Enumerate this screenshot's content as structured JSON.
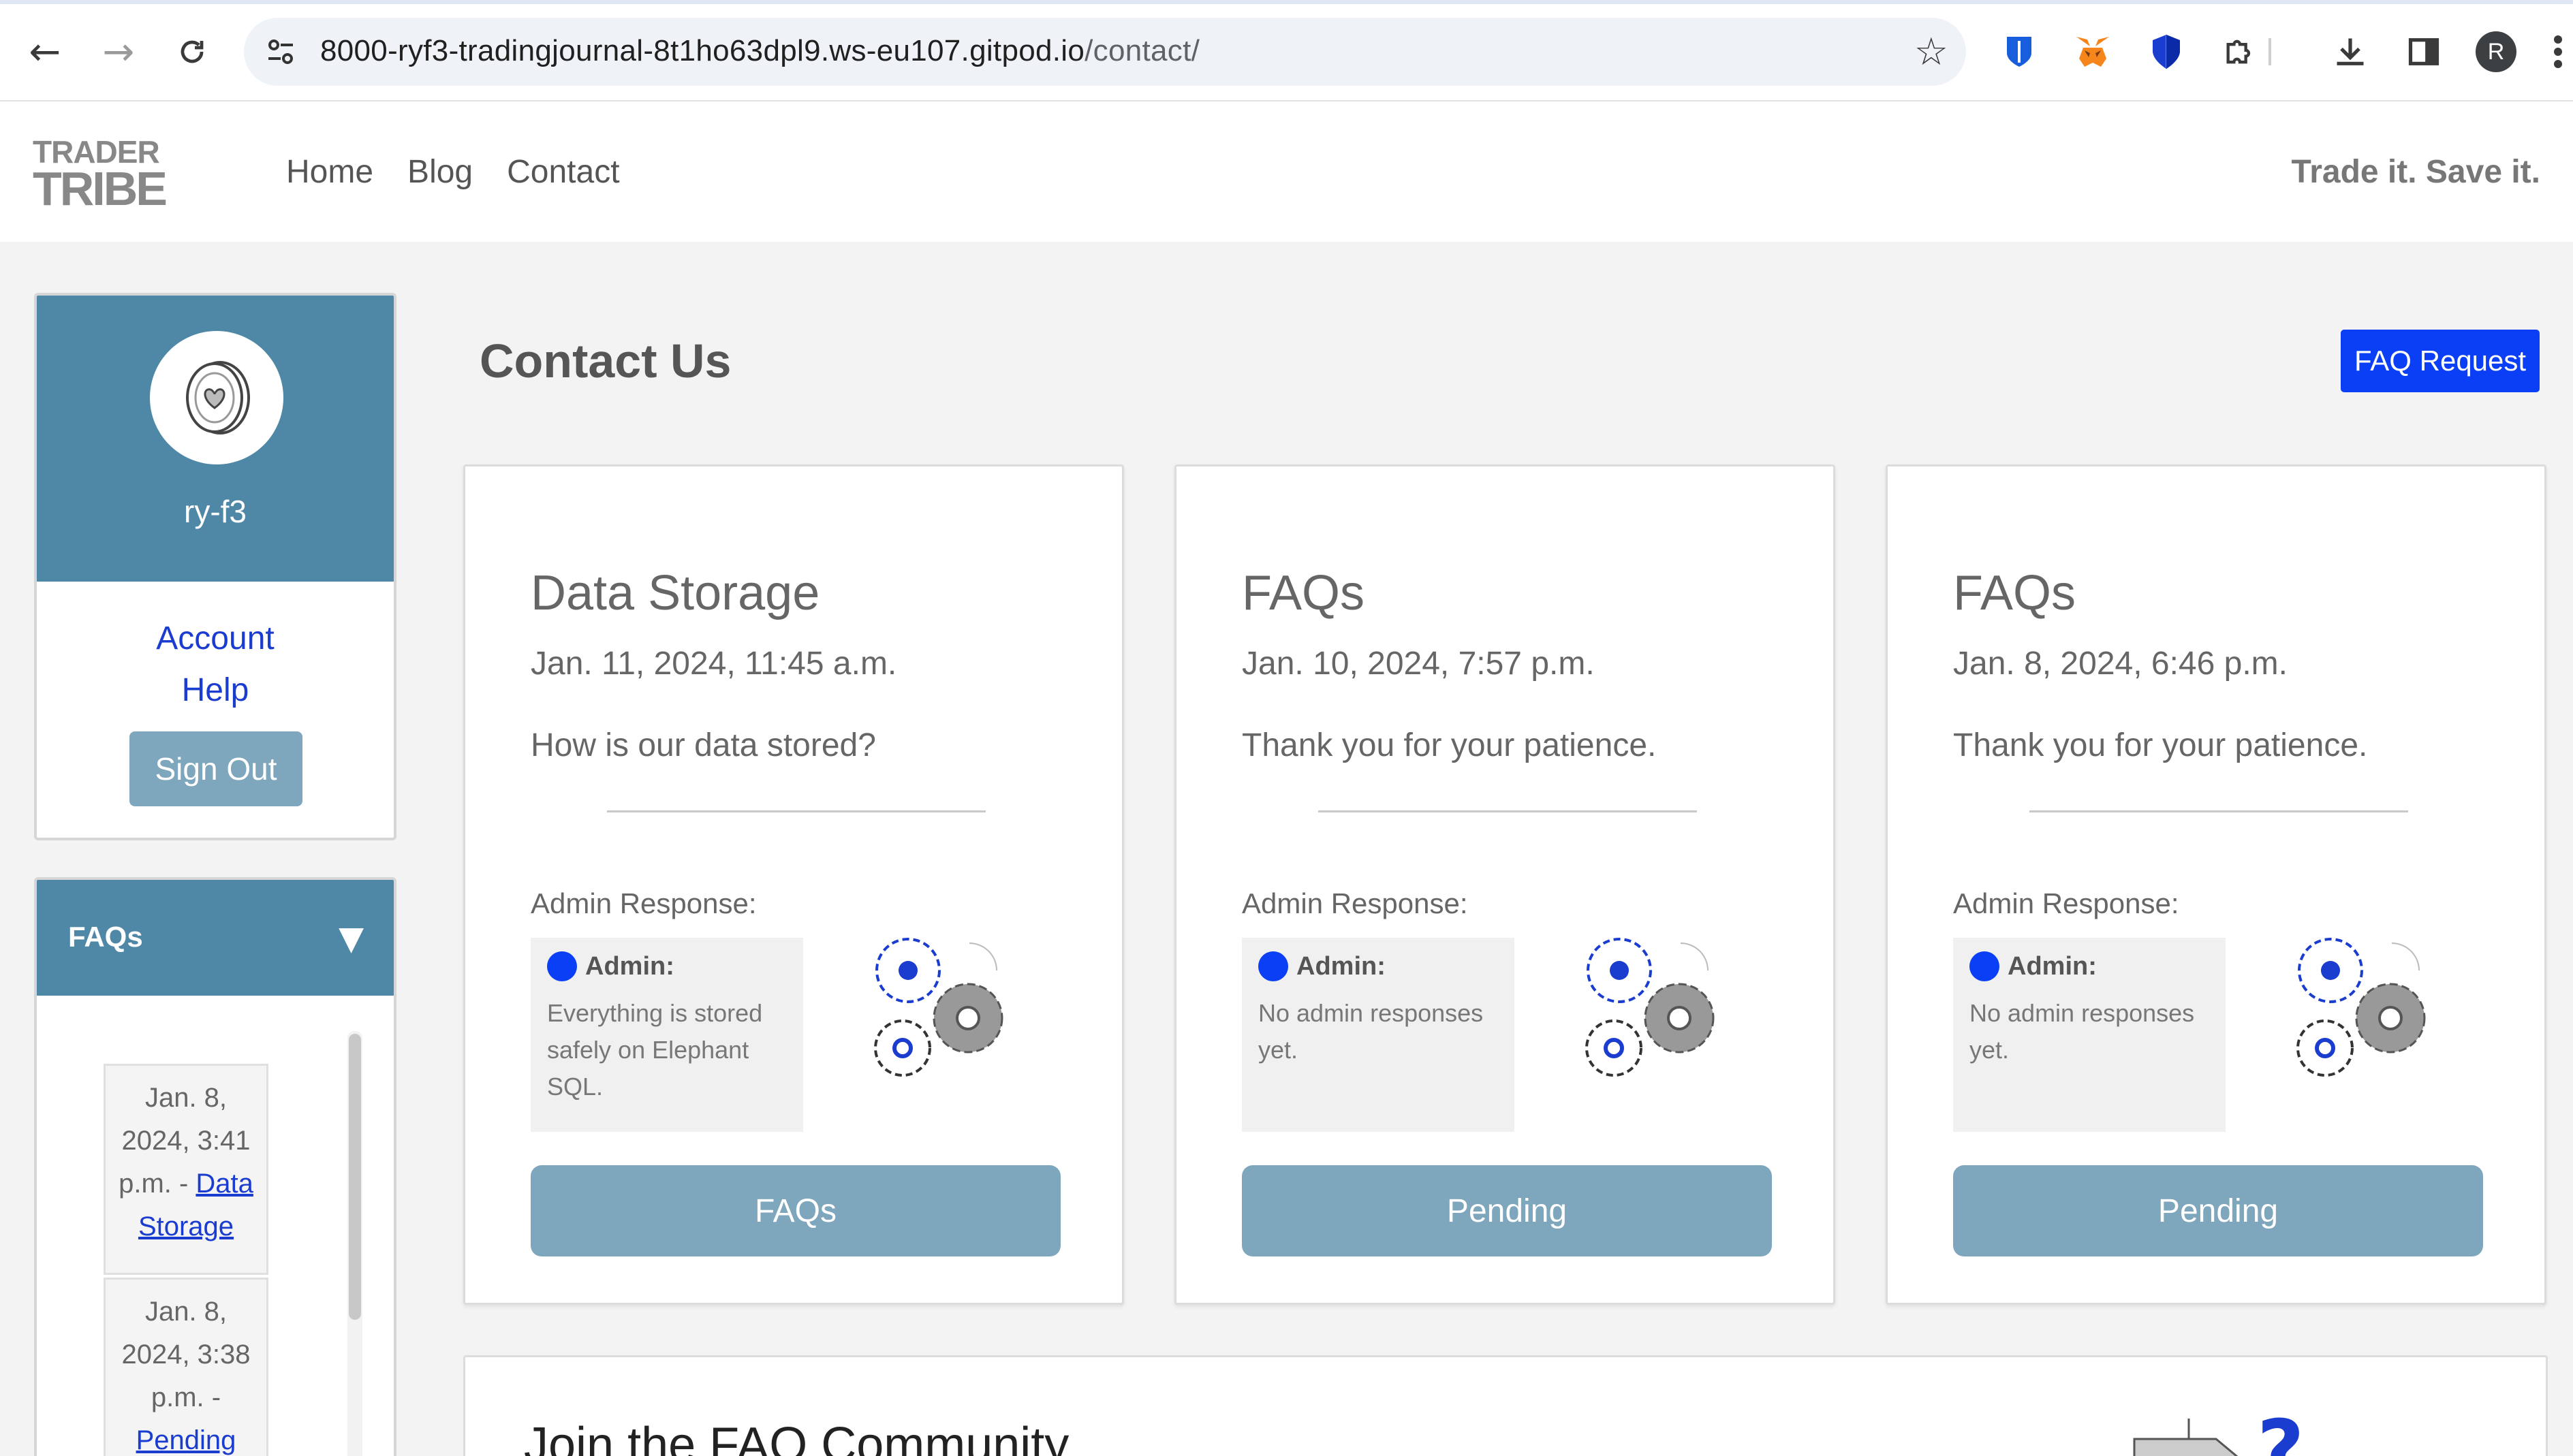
{
  "browser": {
    "url_host": "8000-ryf3-tradingjournal-8t1ho63dpl9.ws-eu107.gitpod.io",
    "url_path": "/contact/",
    "profile_initial": "R"
  },
  "site": {
    "logo_line1": "TRADER",
    "logo_line2": "TRIBE",
    "nav": [
      "Home",
      "Blog",
      "Contact"
    ],
    "slogan": "Trade it. Save it."
  },
  "profile": {
    "username": "ry-f3",
    "links": [
      "Account",
      "Help"
    ],
    "sign_out": "Sign Out"
  },
  "faq_panel": {
    "title": "FAQs",
    "items": [
      {
        "lines": [
          "Jan. 8,",
          "2024, 3:41",
          "p.m. - "
        ],
        "link": [
          "Data",
          "Storage"
        ]
      },
      {
        "lines": [
          "Jan. 8,",
          "2024, 3:38",
          "p.m. -"
        ],
        "link": [
          "Pending"
        ]
      }
    ]
  },
  "main": {
    "title": "Contact Us",
    "faq_request": "FAQ Request",
    "response_label": "Admin Response:",
    "admin_name": "Admin:",
    "cards": [
      {
        "title": "Data Storage",
        "date": "Jan. 11, 2024, 11:45 a.m.",
        "message": "How is our data stored?",
        "response": "Everything is stored safely on Elephant SQL.",
        "status": "FAQs"
      },
      {
        "title": "FAQs",
        "date": "Jan. 10, 2024, 7:57 p.m.",
        "message": "Thank you for your patience.",
        "response": "No admin responses yet.",
        "status": "Pending"
      },
      {
        "title": "FAQs",
        "date": "Jan. 8, 2024, 6:46 p.m.",
        "message": "Thank you for your patience.",
        "response": "No admin responses yet.",
        "status": "Pending"
      }
    ],
    "community_title": "Join the FAQ Community."
  },
  "colors": {
    "accent_blue": "#0a3ff5",
    "header_teal": "#4f87a6",
    "button_muted": "#7ea6bd"
  }
}
